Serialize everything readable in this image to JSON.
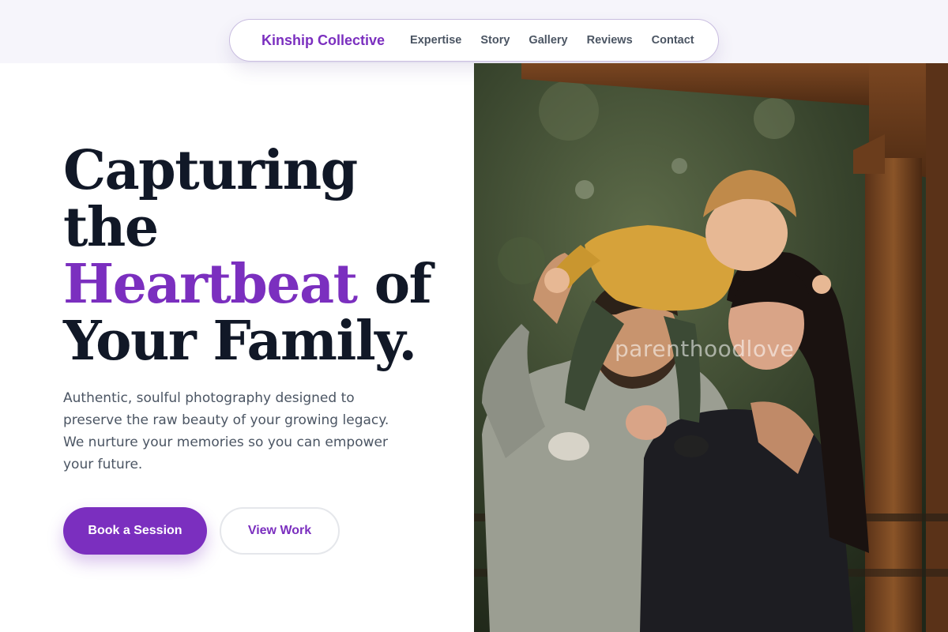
{
  "nav": {
    "brand": "Kinship Collective",
    "links": [
      "Expertise",
      "Story",
      "Gallery",
      "Reviews",
      "Contact"
    ]
  },
  "hero": {
    "headline": {
      "line1": "Capturing",
      "line2": "the",
      "accent": "Heartbeat",
      "after_accent": " of",
      "line4": "Your Family."
    },
    "description": "Authentic, soulful photography designed to preserve the raw beauty of your growing legacy. We nurture your memories so you can empower your future.",
    "primary_button": "Book a Session",
    "secondary_button": "View Work"
  },
  "photo": {
    "watermark": "parenthoodlove"
  },
  "colors": {
    "accent": "#7b2fbf",
    "heading": "#111827",
    "body_text": "#4b5563",
    "nav_band": "#f6f5fb"
  }
}
